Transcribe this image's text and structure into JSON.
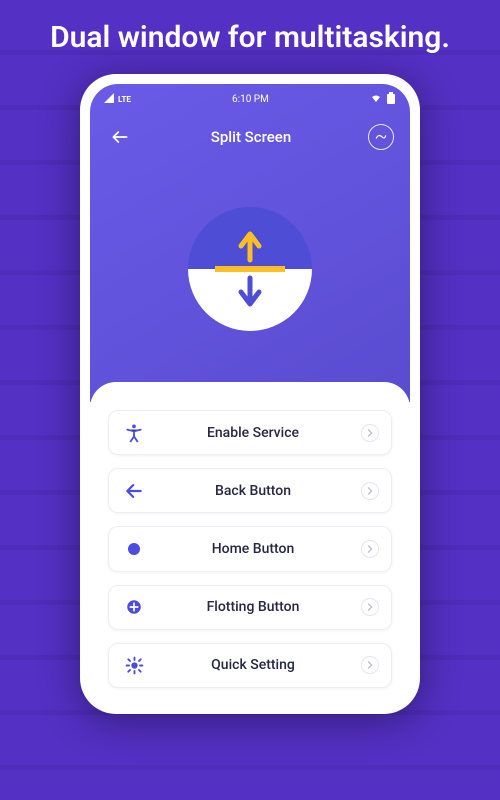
{
  "promo": {
    "title": "Dual window for multitasking."
  },
  "statusbar": {
    "time": "6:10 PM"
  },
  "appbar": {
    "title": "Split Screen"
  },
  "items": [
    {
      "label": "Enable Service",
      "icon": "accessibility"
    },
    {
      "label": "Back Button",
      "icon": "back"
    },
    {
      "label": "Home Button",
      "icon": "circle"
    },
    {
      "label": "Flotting Button",
      "icon": "plus-circle"
    },
    {
      "label": "Quick Setting",
      "icon": "gear"
    }
  ]
}
